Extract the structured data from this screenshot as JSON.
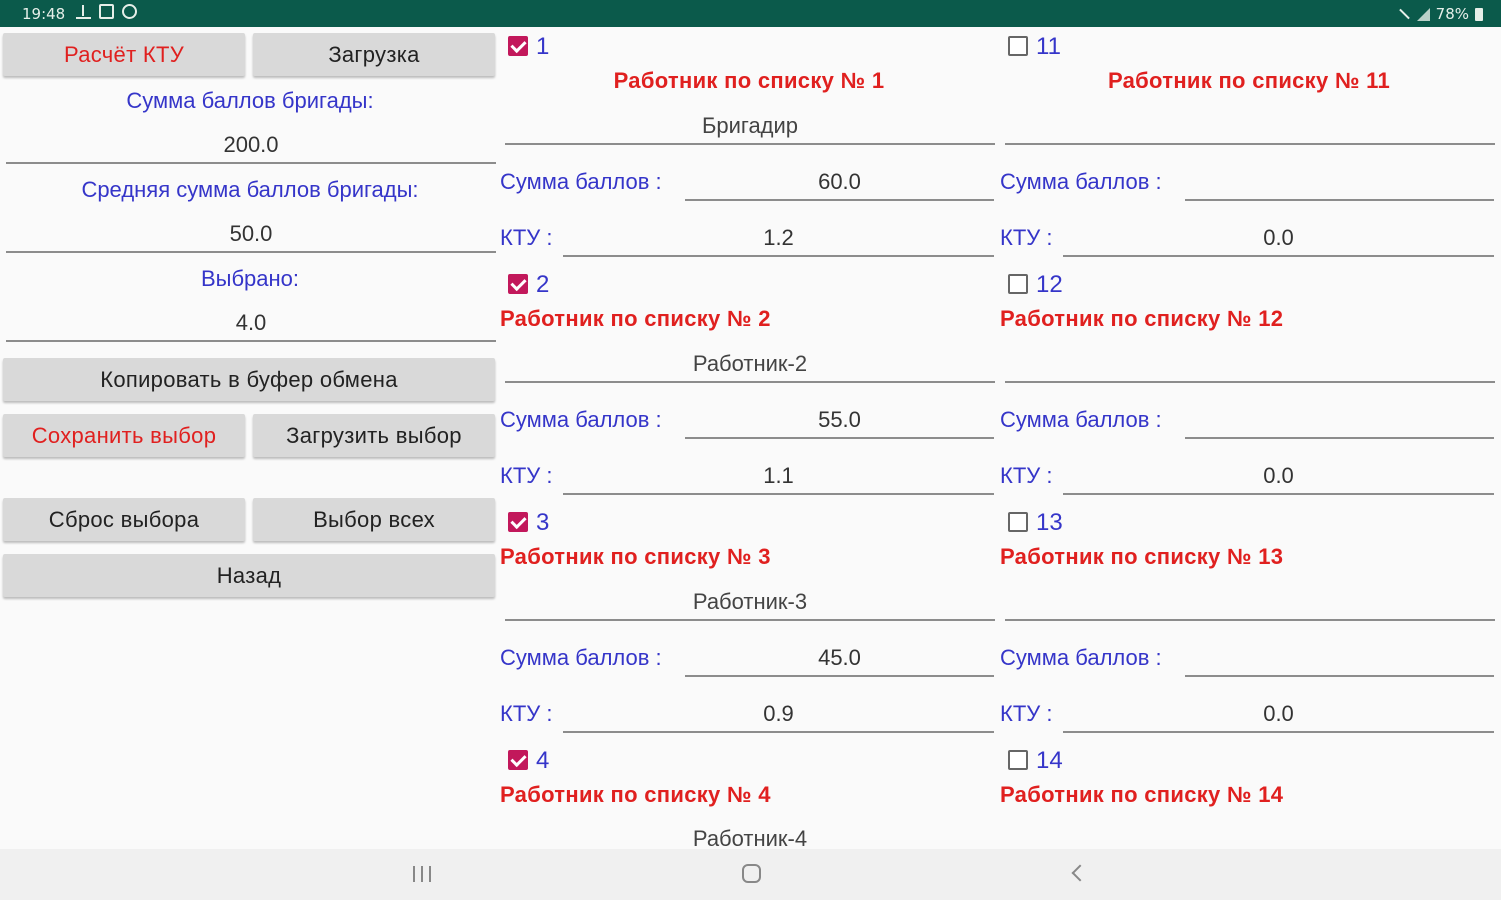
{
  "status_bar": {
    "time": "19:48",
    "battery": "78%"
  },
  "left_panel": {
    "calc_ktu_button": "Расчёт КТУ",
    "load_button": "Загрузка",
    "team_sum_label": "Сумма баллов бригады:",
    "team_sum_value": "200.0",
    "team_avg_label": "Средняя сумма баллов бригады:",
    "team_avg_value": "50.0",
    "selected_label": "Выбрано:",
    "selected_value": "4.0",
    "copy_button": "Копировать в буфер обмена",
    "save_selection_button": "Сохранить выбор",
    "load_selection_button": "Загрузить выбор",
    "reset_selection_button": "Сброс выбора",
    "select_all_button": "Выбор всех",
    "back_button": "Назад"
  },
  "labels": {
    "sum": "Сумма баллов :",
    "ktu": "КТУ :"
  },
  "workers_left": [
    {
      "num": "1",
      "checked": true,
      "title": "Работник по списку № 1",
      "name": "Бригадир",
      "sum": "60.0",
      "ktu": "1.2"
    },
    {
      "num": "2",
      "checked": true,
      "title": "Работник по списку № 2",
      "name": "Работник-2",
      "sum": "55.0",
      "ktu": "1.1"
    },
    {
      "num": "3",
      "checked": true,
      "title": "Работник по списку № 3",
      "name": "Работник-3",
      "sum": "45.0",
      "ktu": "0.9"
    },
    {
      "num": "4",
      "checked": true,
      "title": "Работник по списку № 4",
      "name": "Работник-4"
    }
  ],
  "workers_right": [
    {
      "num": "11",
      "checked": false,
      "title": "Работник по списку № 11",
      "name": "",
      "sum": "",
      "ktu": "0.0"
    },
    {
      "num": "12",
      "checked": false,
      "title": "Работник по списку № 12",
      "name": "",
      "sum": "",
      "ktu": "0.0"
    },
    {
      "num": "13",
      "checked": false,
      "title": "Работник по списку № 13",
      "name": "",
      "sum": "",
      "ktu": "0.0"
    },
    {
      "num": "14",
      "checked": false,
      "title": "Работник по списку № 14"
    }
  ],
  "colors": {
    "status_bar": "#0b5a4b",
    "accent_red": "#e0201f",
    "label_blue": "#3535c9",
    "checkbox": "#c2185b"
  },
  "icons": [
    "upload-icon",
    "image-icon",
    "globe-icon",
    "mute-icon",
    "signal-icon",
    "battery-icon",
    "recent-apps-icon",
    "home-icon",
    "back-icon"
  ]
}
